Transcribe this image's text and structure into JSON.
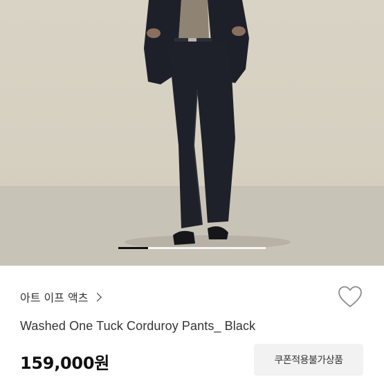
{
  "product_image": {
    "description_icon": "product-photo",
    "carousel": {
      "progress": 0.2
    },
    "colors": {
      "background": "#d8d2c4",
      "floor": "#c7c2b6",
      "garment": "#1e2129"
    }
  },
  "shop": {
    "name": "아트 이프 액츠",
    "icon": "chevron-right-icon"
  },
  "wishlist": {
    "icon": "heart-outline-icon"
  },
  "product": {
    "title": "Washed One Tuck Corduroy Pants_ Black",
    "price": "159,000원"
  },
  "coupon": {
    "label": "쿠폰적용불가상품"
  }
}
